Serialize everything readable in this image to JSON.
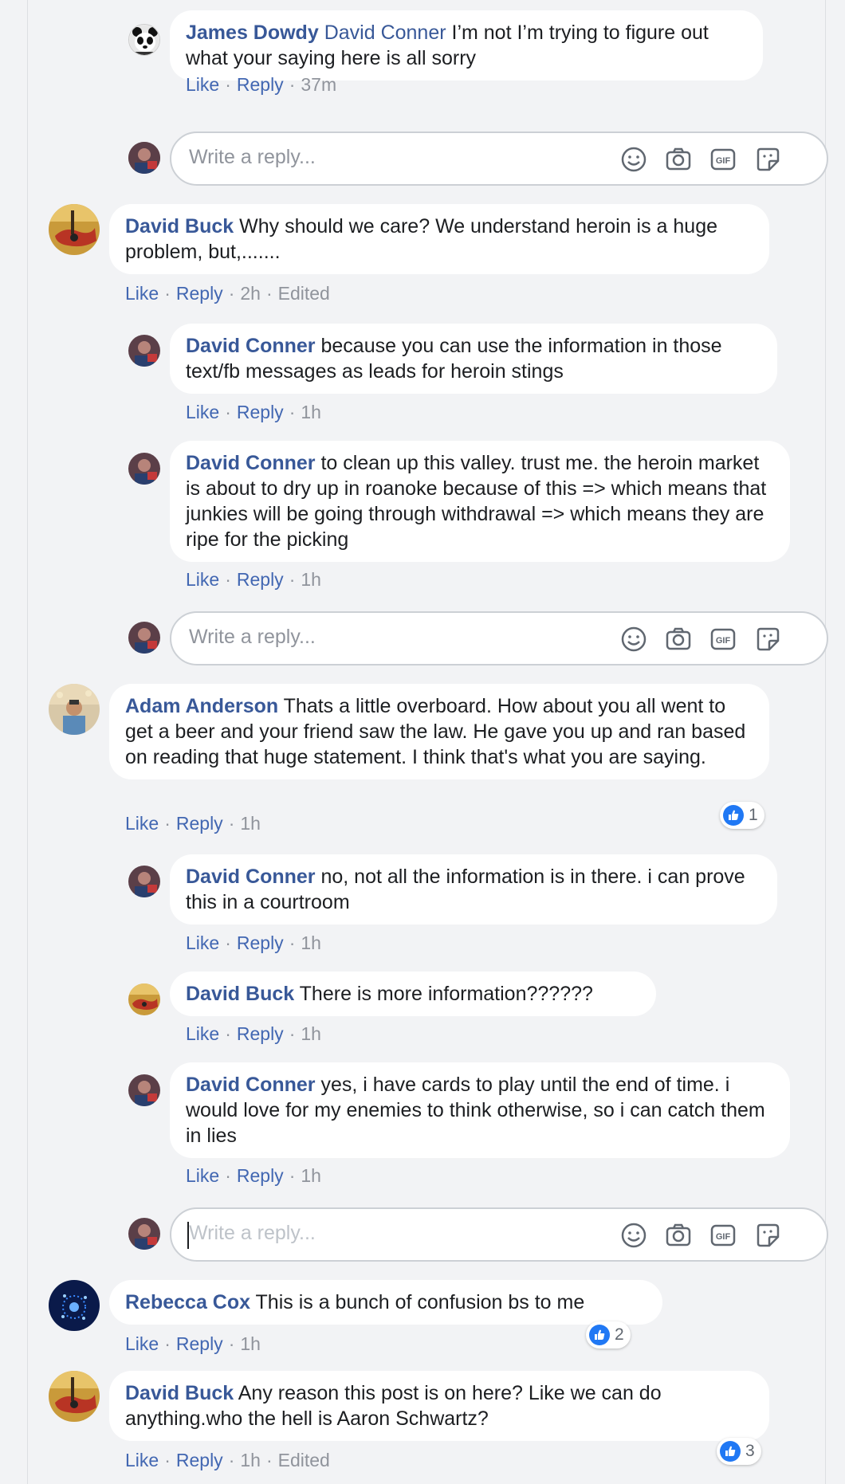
{
  "comments": [
    {
      "name": "James Dowdy",
      "tag": "David Conner",
      "text": " I’m not I’m trying to figure out what your saying here is all sorry",
      "like": "Like",
      "reply": "Reply",
      "time": "37m"
    },
    {
      "name": "David Buck",
      "text": " Why should we care? We understand heroin is a huge problem, but,.......",
      "like": "Like",
      "reply": "Reply",
      "time": "2h",
      "edited": "Edited"
    },
    {
      "name": "David Conner",
      "text": " because you can use the information in those text/fb messages as leads for heroin stings",
      "like": "Like",
      "reply": "Reply",
      "time": "1h"
    },
    {
      "name": "David Conner",
      "text": " to clean up this valley. trust me. the heroin market is about to dry up in roanoke because of this => which means that junkies will be going through withdrawal => which means they are ripe for the picking",
      "like": "Like",
      "reply": "Reply",
      "time": "1h"
    },
    {
      "name": "Adam Anderson",
      "text": " Thats a little overboard. How about you all went to get a beer and your friend saw the law. He gave you up and ran based on reading that huge statement. I think that's what you are saying.",
      "like": "Like",
      "reply": "Reply",
      "time": "1h",
      "reactions": "1"
    },
    {
      "name": "David Conner",
      "text": " no, not all the information is in there. i can prove this in a courtroom",
      "like": "Like",
      "reply": "Reply",
      "time": "1h"
    },
    {
      "name": "David Buck",
      "text": " There is more information??????",
      "like": "Like",
      "reply": "Reply",
      "time": "1h"
    },
    {
      "name": "David Conner",
      "text": " yes, i have cards to play until the end of time. i would love for my enemies to think otherwise, so i can catch them in lies",
      "like": "Like",
      "reply": "Reply",
      "time": "1h"
    },
    {
      "name": "Rebecca Cox",
      "text": " This is a bunch of confusion bs to me",
      "like": "Like",
      "reply": "Reply",
      "time": "1h",
      "reactions": "2"
    },
    {
      "name": "David Buck",
      "text": " Any reason this post is on here? Like we can do anything.who the hell is Aaron Schwartz?",
      "like": "Like",
      "reply": "Reply",
      "time": "1h",
      "edited": "Edited",
      "reactions": "3"
    }
  ],
  "reply_placeholder": "Write a reply...",
  "icons": [
    "emoji-icon",
    "camera-icon",
    "gif-icon",
    "sticker-icon"
  ],
  "colors": {
    "name": "#385898",
    "link": "#4267b2",
    "meta": "#90949c",
    "like_blue": "#2078f4"
  }
}
